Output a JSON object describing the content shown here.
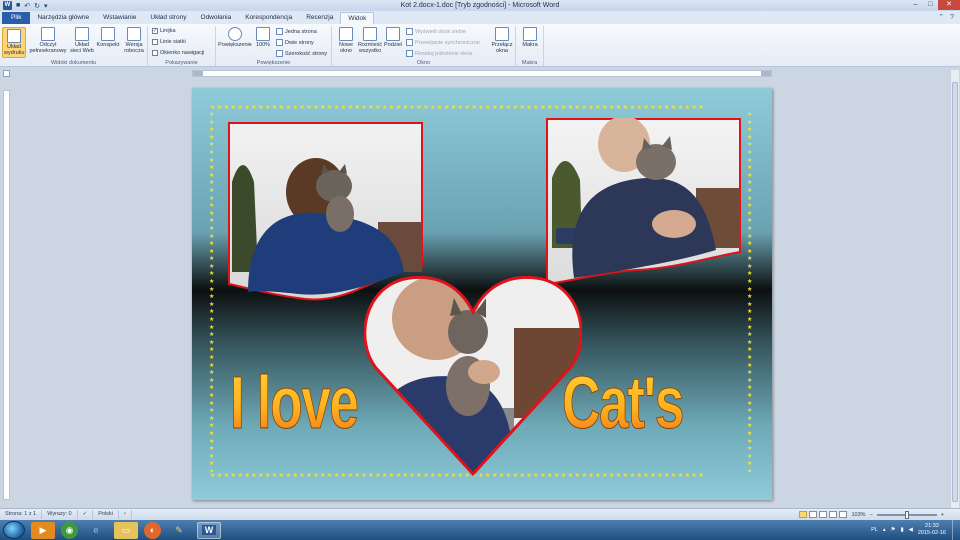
{
  "window": {
    "title": "Kot 2.docx-1.doc [Tryb zgodności] - Microsoft Word",
    "app_icon": "word-icon"
  },
  "tabs": [
    "Plik",
    "Narzędzia główne",
    "Wstawianie",
    "Układ strony",
    "Odwołania",
    "Korespondencja",
    "Recenzja",
    "Widok"
  ],
  "active_tab": "Widok",
  "ribbon": {
    "views": {
      "label": "Widoki dokumentu",
      "print_layout": "Układ wydruku",
      "full_screen": "Odczyt pełnoekranowy",
      "web_layout": "Układ sieci Web",
      "outline": "Konspekt",
      "draft": "Wersja robocza"
    },
    "show": {
      "label": "Pokazywanie",
      "ruler": "Linijka",
      "ruler_checked": true,
      "gridlines": "Linie siatki",
      "gridlines_checked": false,
      "nav_pane": "Okienko nawigacji",
      "nav_pane_checked": false
    },
    "zoom": {
      "label": "Powiększenie",
      "zoom": "Powiększenie",
      "hundred": "100%",
      "one_page": "Jedna strona",
      "two_pages": "Dwie strony",
      "page_width": "Szerokość strony"
    },
    "window": {
      "label": "Okno",
      "new_window": "Nowe okno",
      "arrange_all": "Rozmieść wszystko",
      "split": "Podziel",
      "side_by_side": "Wyświetl obok siebie",
      "sync_scroll": "Przewijanie synchroniczne",
      "reset_position": "Resetuj położenie okna",
      "switch_windows": "Przełącz okna"
    },
    "macros": {
      "label": "Makra",
      "macros": "Makra"
    }
  },
  "document": {
    "wordart_left": "I love",
    "wordart_right": "Cat's",
    "frame_color": "#e0121a",
    "star_color": "#f1e13b",
    "background_top": "#8ecbd9",
    "background_middle": "#0c0f10"
  },
  "statusbar": {
    "page": "Strona: 1 z 1",
    "words": "Wyrazy: 0",
    "language": "Polski",
    "zoom": "103%"
  },
  "taskbar": {
    "apps": [
      "media-player-icon",
      "chrome-icon",
      "internet-explorer-icon",
      "file-explorer-icon",
      "firefox-icon",
      "paint-icon",
      "word-icon"
    ],
    "language": "PL",
    "time": "21:33",
    "date": "2015-02-16"
  }
}
